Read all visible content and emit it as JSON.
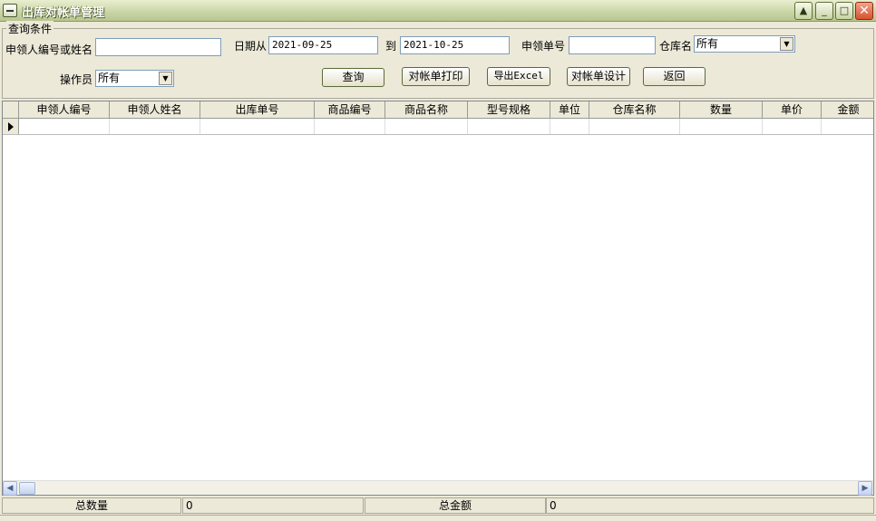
{
  "window": {
    "title": "出库对帐单管理"
  },
  "query": {
    "group_label": "查询条件",
    "applicant_label": "申领人编号或姓名",
    "applicant_value": "",
    "date_from_label": "日期从",
    "date_from": "2021-09-25",
    "date_to_label": "到",
    "date_to": "2021-10-25",
    "order_no_label": "申领单号",
    "order_no_value": "",
    "warehouse_label": "仓库名",
    "warehouse_value": "所有",
    "operator_label": "操作员",
    "operator_value": "所有"
  },
  "buttons": {
    "query": "查询",
    "print": "对帐单打印",
    "export": "导出Excel",
    "design": "对帐单设计",
    "back": "返回"
  },
  "grid": {
    "columns": [
      "申领人编号",
      "申领人姓名",
      "出库单号",
      "商品编号",
      "商品名称",
      "型号规格",
      "单位",
      "仓库名称",
      "数量",
      "单价",
      "金额"
    ]
  },
  "footer": {
    "total_qty_label": "总数量",
    "total_qty": "0",
    "total_amount_label": "总金额",
    "total_amount": "0"
  }
}
